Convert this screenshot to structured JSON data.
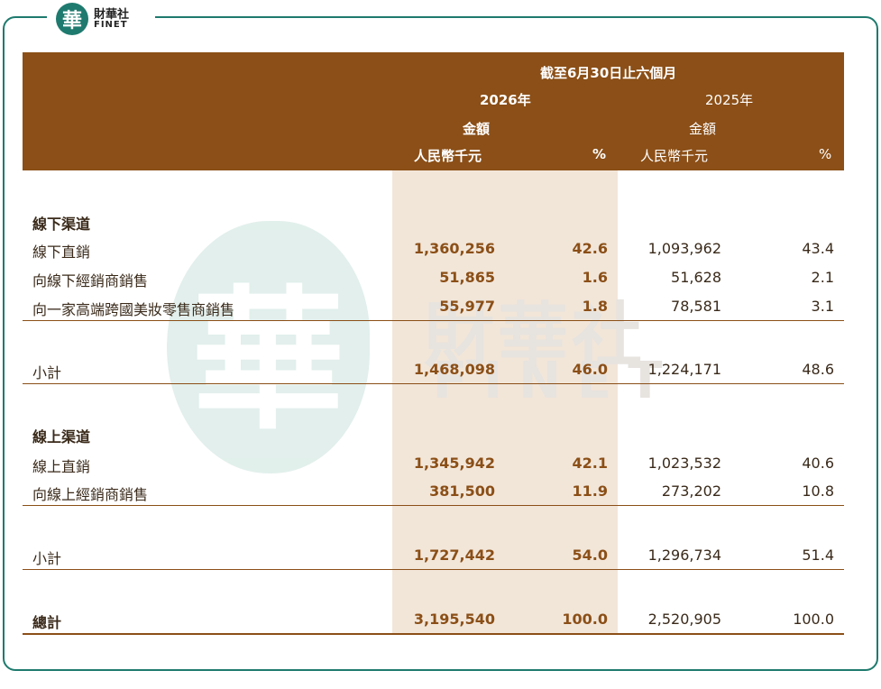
{
  "brand": {
    "mark": "華",
    "name_cn": "財華社",
    "name_en": "FINET"
  },
  "header": {
    "period": "截至6月30日止六個月",
    "year_2026": "2026年",
    "year_2025": "2025年",
    "amount_2026": "金額",
    "amount_2025": "金額",
    "unit_2026": "人民幣千元",
    "unit_2025": "人民幣千元",
    "pct_2026": "%",
    "pct_2025": "%"
  },
  "offline": {
    "title": "線下渠道",
    "rows": [
      {
        "label": "線下直銷",
        "v2026": "1,360,256",
        "p2026": "42.6",
        "v2025": "1,093,962",
        "p2025": "43.4"
      },
      {
        "label": "向線下經銷商銷售",
        "v2026": "51,865",
        "p2026": "1.6",
        "v2025": "51,628",
        "p2025": "2.1"
      },
      {
        "label": "向一家高端跨國美妝零售商銷售",
        "v2026": "55,977",
        "p2026": "1.8",
        "v2025": "78,581",
        "p2025": "3.1"
      }
    ],
    "subtotal": {
      "label": "小計",
      "v2026": "1,468,098",
      "p2026": "46.0",
      "v2025": "1,224,171",
      "p2025": "48.6"
    }
  },
  "online": {
    "title": "線上渠道",
    "rows": [
      {
        "label": "線上直銷",
        "v2026": "1,345,942",
        "p2026": "42.1",
        "v2025": "1,023,532",
        "p2025": "40.6"
      },
      {
        "label": "向線上經銷商銷售",
        "v2026": "381,500",
        "p2026": "11.9",
        "v2025": "273,202",
        "p2025": "10.8"
      }
    ],
    "subtotal": {
      "label": "小計",
      "v2026": "1,727,442",
      "p2026": "54.0",
      "v2025": "1,296,734",
      "p2025": "51.4"
    }
  },
  "total": {
    "label": "總計",
    "v2026": "3,195,540",
    "p2026": "100.0",
    "v2025": "2,520,905",
    "p2025": "100.0"
  },
  "watermark": {
    "mark": "華",
    "cn": "財華社",
    "en": "FINET"
  },
  "colors": {
    "brand_teal": "#1e7a6e",
    "header_brown": "#8b4f17",
    "shade": "#f2e6d9"
  }
}
